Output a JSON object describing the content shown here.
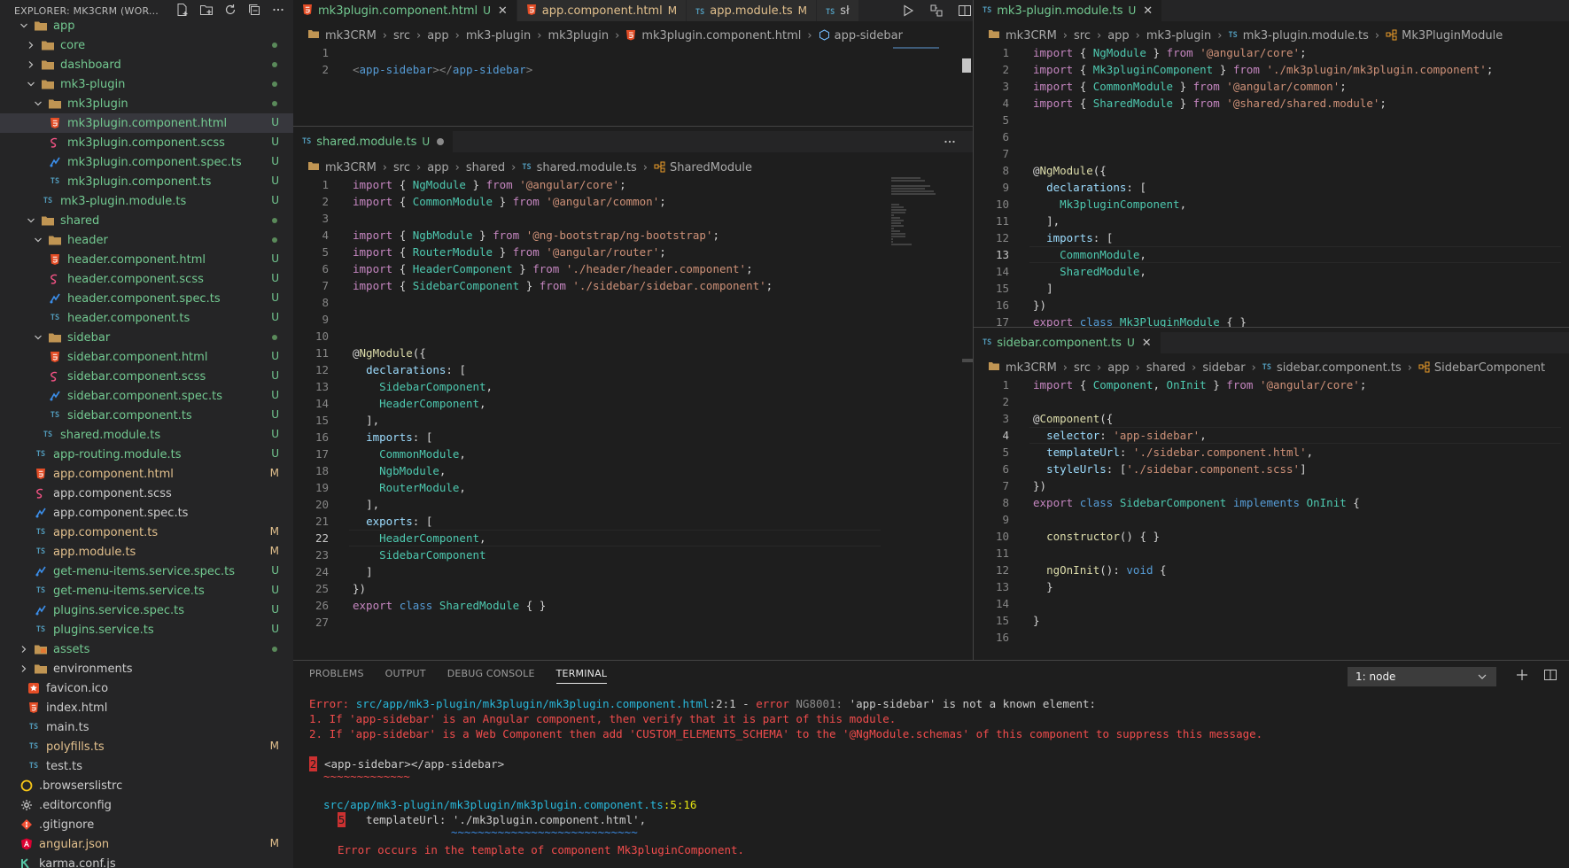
{
  "explorer": {
    "title": "EXPLORER: MK3CRM (WOR...",
    "icons": [
      "new-file-icon",
      "new-folder-icon",
      "refresh-icon",
      "collapse-all-icon",
      "more-icon"
    ],
    "items": [
      {
        "label": "app",
        "kind": "folder",
        "open": true,
        "indent": 1,
        "color": "green",
        "badge": "",
        "dot": false
      },
      {
        "label": "core",
        "kind": "folder",
        "open": false,
        "indent": 2,
        "color": "green",
        "badge": "",
        "dot": true
      },
      {
        "label": "dashboard",
        "kind": "folder",
        "open": false,
        "indent": 2,
        "color": "green",
        "badge": "",
        "dot": true
      },
      {
        "label": "mk3-plugin",
        "kind": "folder",
        "open": true,
        "indent": 2,
        "color": "green",
        "badge": "",
        "dot": true
      },
      {
        "label": "mk3plugin",
        "kind": "folder",
        "open": true,
        "indent": 3,
        "color": "green",
        "badge": "",
        "dot": true
      },
      {
        "label": "mk3plugin.component.html",
        "kind": "html",
        "indent": 4,
        "color": "green",
        "badge": "U",
        "selected": true
      },
      {
        "label": "mk3plugin.component.scss",
        "kind": "scss",
        "indent": 4,
        "color": "green",
        "badge": "U"
      },
      {
        "label": "mk3plugin.component.spec.ts",
        "kind": "spec",
        "indent": 4,
        "color": "green",
        "badge": "U"
      },
      {
        "label": "mk3plugin.component.ts",
        "kind": "ts",
        "indent": 4,
        "color": "green",
        "badge": "U"
      },
      {
        "label": "mk3-plugin.module.ts",
        "kind": "ts",
        "indent": 3,
        "color": "green",
        "badge": "U"
      },
      {
        "label": "shared",
        "kind": "folder",
        "open": true,
        "indent": 2,
        "color": "green",
        "badge": "",
        "dot": true
      },
      {
        "label": "header",
        "kind": "folder",
        "open": true,
        "indent": 3,
        "color": "green",
        "badge": "",
        "dot": true
      },
      {
        "label": "header.component.html",
        "kind": "html",
        "indent": 4,
        "color": "green",
        "badge": "U"
      },
      {
        "label": "header.component.scss",
        "kind": "scss",
        "indent": 4,
        "color": "green",
        "badge": "U"
      },
      {
        "label": "header.component.spec.ts",
        "kind": "spec",
        "indent": 4,
        "color": "green",
        "badge": "U"
      },
      {
        "label": "header.component.ts",
        "kind": "ts",
        "indent": 4,
        "color": "green",
        "badge": "U"
      },
      {
        "label": "sidebar",
        "kind": "folder",
        "open": true,
        "indent": 3,
        "color": "green",
        "badge": "",
        "dot": true
      },
      {
        "label": "sidebar.component.html",
        "kind": "html",
        "indent": 4,
        "color": "green",
        "badge": "U"
      },
      {
        "label": "sidebar.component.scss",
        "kind": "scss",
        "indent": 4,
        "color": "green",
        "badge": "U"
      },
      {
        "label": "sidebar.component.spec.ts",
        "kind": "spec",
        "indent": 4,
        "color": "green",
        "badge": "U"
      },
      {
        "label": "sidebar.component.ts",
        "kind": "ts",
        "indent": 4,
        "color": "green",
        "badge": "U"
      },
      {
        "label": "shared.module.ts",
        "kind": "ts",
        "indent": 3,
        "color": "green",
        "badge": "U"
      },
      {
        "label": "app-routing.module.ts",
        "kind": "ts",
        "indent": 2,
        "color": "green",
        "badge": "U"
      },
      {
        "label": "app.component.html",
        "kind": "html",
        "indent": 2,
        "color": "yellow",
        "badge": "M"
      },
      {
        "label": "app.component.scss",
        "kind": "scss",
        "indent": 2,
        "color": "plain",
        "badge": ""
      },
      {
        "label": "app.component.spec.ts",
        "kind": "spec",
        "indent": 2,
        "color": "plain",
        "badge": ""
      },
      {
        "label": "app.component.ts",
        "kind": "ts",
        "indent": 2,
        "color": "yellow",
        "badge": "M"
      },
      {
        "label": "app.module.ts",
        "kind": "ts",
        "indent": 2,
        "color": "yellow",
        "badge": "M"
      },
      {
        "label": "get-menu-items.service.spec.ts",
        "kind": "spec",
        "indent": 2,
        "color": "green",
        "badge": "U"
      },
      {
        "label": "get-menu-items.service.ts",
        "kind": "ts",
        "indent": 2,
        "color": "green",
        "badge": "U"
      },
      {
        "label": "plugins.service.spec.ts",
        "kind": "spec",
        "indent": 2,
        "color": "green",
        "badge": "U"
      },
      {
        "label": "plugins.service.ts",
        "kind": "ts",
        "indent": 2,
        "color": "green",
        "badge": "U"
      },
      {
        "label": "assets",
        "kind": "folder-assets",
        "open": false,
        "indent": 1,
        "color": "green",
        "badge": "",
        "dot": true
      },
      {
        "label": "environments",
        "kind": "folder",
        "open": false,
        "indent": 1,
        "color": "plain",
        "badge": ""
      },
      {
        "label": "favicon.ico",
        "kind": "favicon",
        "indent": 1,
        "color": "plain",
        "badge": ""
      },
      {
        "label": "index.html",
        "kind": "html",
        "indent": 1,
        "color": "plain",
        "badge": ""
      },
      {
        "label": "main.ts",
        "kind": "ts",
        "indent": 1,
        "color": "plain",
        "badge": ""
      },
      {
        "label": "polyfills.ts",
        "kind": "ts",
        "indent": 1,
        "color": "yellow",
        "badge": "M"
      },
      {
        "label": "test.ts",
        "kind": "ts",
        "indent": 1,
        "color": "plain",
        "badge": ""
      },
      {
        "label": ".browserslistrc",
        "kind": "browsers",
        "indent": 0,
        "color": "plain",
        "badge": ""
      },
      {
        "label": ".editorconfig",
        "kind": "gear",
        "indent": 0,
        "color": "plain",
        "badge": ""
      },
      {
        "label": ".gitignore",
        "kind": "git",
        "indent": 0,
        "color": "plain",
        "badge": ""
      },
      {
        "label": "angular.json",
        "kind": "angular",
        "indent": 0,
        "color": "yellow",
        "badge": "M"
      },
      {
        "label": "karma.conf.js",
        "kind": "karma",
        "indent": 0,
        "color": "plain",
        "badge": ""
      }
    ]
  },
  "top_left_group": {
    "tabs": [
      {
        "label": "mk3plugin.component.html",
        "icon": "html",
        "mod": "U",
        "active": true,
        "close": true,
        "color": "green"
      },
      {
        "label": "app.component.html",
        "icon": "html",
        "mod": "M",
        "active": false,
        "close": false,
        "color": "yellow"
      },
      {
        "label": "app.module.ts",
        "icon": "ts",
        "mod": "M",
        "active": false,
        "close": false,
        "color": "yellow"
      },
      {
        "label": "sł",
        "icon": "ts",
        "mod": "",
        "active": false,
        "close": false,
        "color": "plain"
      }
    ],
    "actions": [
      "run-icon",
      "compare-icon",
      "split-editor-icon",
      "more-icon"
    ],
    "breadcrumb": [
      "mk3CRM",
      "src",
      "app",
      "mk3-plugin",
      "mk3plugin",
      "mk3plugin.component.html",
      "app-sidebar"
    ],
    "lines": [
      {
        "n": "1",
        "code": ""
      },
      {
        "n": "2",
        "code": "<app-sidebar></app-sidebar>"
      }
    ]
  },
  "shared_group": {
    "tab": {
      "label": "shared.module.ts",
      "mod": "U"
    },
    "breadcrumb": [
      "mk3CRM",
      "src",
      "app",
      "shared",
      "shared.module.ts",
      "SharedModule"
    ],
    "lines": [
      {
        "n": "1",
        "code": "import { NgModule } from '@angular/core';"
      },
      {
        "n": "2",
        "code": "import { CommonModule } from '@angular/common';"
      },
      {
        "n": "3",
        "code": ""
      },
      {
        "n": "4",
        "code": "import { NgbModule } from '@ng-bootstrap/ng-bootstrap';"
      },
      {
        "n": "5",
        "code": "import { RouterModule } from '@angular/router';"
      },
      {
        "n": "6",
        "code": "import { HeaderComponent } from './header/header.component';"
      },
      {
        "n": "7",
        "code": "import { SidebarComponent } from './sidebar/sidebar.component';"
      },
      {
        "n": "8",
        "code": ""
      },
      {
        "n": "9",
        "code": ""
      },
      {
        "n": "10",
        "code": ""
      },
      {
        "n": "11",
        "code": "@NgModule({"
      },
      {
        "n": "12",
        "code": "  declarations: ["
      },
      {
        "n": "13",
        "code": "    SidebarComponent,"
      },
      {
        "n": "14",
        "code": "    HeaderComponent,"
      },
      {
        "n": "15",
        "code": "  ],"
      },
      {
        "n": "16",
        "code": "  imports: ["
      },
      {
        "n": "17",
        "code": "    CommonModule,"
      },
      {
        "n": "18",
        "code": "    NgbModule,"
      },
      {
        "n": "19",
        "code": "    RouterModule,"
      },
      {
        "n": "20",
        "code": "  ],"
      },
      {
        "n": "21",
        "code": "  exports: ["
      },
      {
        "n": "22",
        "code": "    HeaderComponent,"
      },
      {
        "n": "23",
        "code": "    SidebarComponent"
      },
      {
        "n": "24",
        "code": "  ]"
      },
      {
        "n": "25",
        "code": "})"
      },
      {
        "n": "26",
        "code": "export class SharedModule { }"
      },
      {
        "n": "27",
        "code": ""
      }
    ]
  },
  "module_group": {
    "tab": {
      "label": "mk3-plugin.module.ts",
      "mod": "U"
    },
    "breadcrumb": [
      "mk3CRM",
      "src",
      "app",
      "mk3-plugin",
      "mk3-plugin.module.ts",
      "Mk3PluginModule"
    ],
    "lines": [
      {
        "n": "1",
        "code": "import { NgModule } from '@angular/core';"
      },
      {
        "n": "2",
        "code": "import { Mk3pluginComponent } from './mk3plugin/mk3plugin.component';"
      },
      {
        "n": "3",
        "code": "import { CommonModule } from '@angular/common';"
      },
      {
        "n": "4",
        "code": "import { SharedModule } from '@shared/shared.module';"
      },
      {
        "n": "5",
        "code": ""
      },
      {
        "n": "6",
        "code": ""
      },
      {
        "n": "7",
        "code": ""
      },
      {
        "n": "8",
        "code": "@NgModule({"
      },
      {
        "n": "9",
        "code": "  declarations: ["
      },
      {
        "n": "10",
        "code": "    Mk3pluginComponent,"
      },
      {
        "n": "11",
        "code": "  ],"
      },
      {
        "n": "12",
        "code": "  imports: ["
      },
      {
        "n": "13",
        "code": "    CommonModule,"
      },
      {
        "n": "14",
        "code": "    SharedModule,"
      },
      {
        "n": "15",
        "code": "  ]"
      },
      {
        "n": "16",
        "code": "})"
      },
      {
        "n": "17",
        "code": "export class Mk3PluginModule { }"
      }
    ]
  },
  "sidebar_comp_group": {
    "tab": {
      "label": "sidebar.component.ts",
      "mod": "U"
    },
    "breadcrumb": [
      "mk3CRM",
      "src",
      "app",
      "shared",
      "sidebar",
      "sidebar.component.ts",
      "SidebarComponent"
    ],
    "lines": [
      {
        "n": "1",
        "code": "import { Component, OnInit } from '@angular/core';"
      },
      {
        "n": "2",
        "code": ""
      },
      {
        "n": "3",
        "code": "@Component({"
      },
      {
        "n": "4",
        "code": "  selector: 'app-sidebar',"
      },
      {
        "n": "5",
        "code": "  templateUrl: './sidebar.component.html',"
      },
      {
        "n": "6",
        "code": "  styleUrls: ['./sidebar.component.scss']"
      },
      {
        "n": "7",
        "code": "})"
      },
      {
        "n": "8",
        "code": "export class SidebarComponent implements OnInit {"
      },
      {
        "n": "9",
        "code": ""
      },
      {
        "n": "10",
        "code": "  constructor() { }"
      },
      {
        "n": "11",
        "code": ""
      },
      {
        "n": "12",
        "code": "  ngOnInit(): void {"
      },
      {
        "n": "13",
        "code": "  }"
      },
      {
        "n": "14",
        "code": ""
      },
      {
        "n": "15",
        "code": "}"
      },
      {
        "n": "16",
        "code": ""
      }
    ]
  },
  "panel": {
    "tabs": [
      "PROBLEMS",
      "OUTPUT",
      "DEBUG CONSOLE",
      "TERMINAL"
    ],
    "active_tab": "TERMINAL",
    "terminal_select": "1: node",
    "actions": [
      "add-terminal-icon",
      "split-terminal-icon"
    ],
    "terminal": {
      "err_prefix": "Error: ",
      "err_path": "src/app/mk3-plugin/mk3plugin/mk3plugin.component.html",
      "err_loc": ":2:1",
      "err_sep": " - ",
      "err_word": "error",
      "err_code": " NG8001: ",
      "err_msg": "'app-sidebar' is not a known element:",
      "line1": "1. If 'app-sidebar' is an Angular component, then verify that it is part of this module.",
      "line2": "2. If 'app-sidebar' is a Web Component then add 'CUSTOM_ELEMENTS_SCHEMA' to the '@NgModule.schemas' of this component to suppress this message.",
      "snippet_num": "2",
      "snippet": "<app-sidebar></app-sidebar>",
      "snippet_underline": "~~~~~~~~~~~~~",
      "ref_path": "src/app/mk3-plugin/mk3plugin/mk3plugin.component.ts",
      "ref_loc": ":5:16",
      "ref_num": "5",
      "ref_code": "  templateUrl: './mk3plugin.component.html',",
      "ref_underline": "~~~~~~~~~~~~~~~~~~~~~~~~~~~~",
      "occurs": "Error occurs in the template of component Mk3pluginComponent."
    }
  }
}
